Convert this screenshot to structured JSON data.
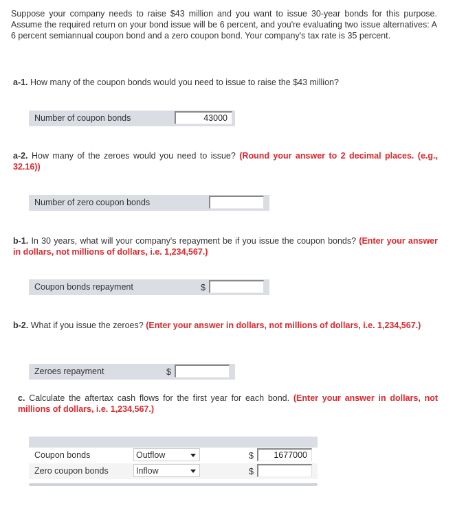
{
  "intro": "Suppose your company needs to raise $43 million and you want to issue 30-year bonds for this purpose. Assume the required return on your bond issue will be 6 percent, and you're evaluating two issue alternatives: A 6 percent semiannual coupon bond and a zero coupon bond. Your company's tax rate is 35 percent.",
  "questions": {
    "a1": {
      "label": "a-1.",
      "text": "How many of the coupon bonds would you need to issue to raise the $43 million?",
      "hint": ""
    },
    "a2": {
      "label": "a-2.",
      "text": "How many of the zeroes would you need to issue?",
      "hint": "(Round your answer to 2 decimal places. (e.g., 32.16))"
    },
    "b1": {
      "label": "b-1.",
      "text": "In 30 years, what will your company's repayment be if you issue the coupon bonds?",
      "hint": "(Enter your answer in dollars, not millions of dollars, i.e. 1,234,567.)"
    },
    "b2": {
      "label": "b-2.",
      "text": "What if you issue the zeroes?",
      "hint": "(Enter your answer in dollars, not millions of dollars, i.e. 1,234,567.)"
    },
    "c": {
      "label": "c.",
      "text": "Calculate the aftertax cash flows for the first year for each bond.",
      "hint": "(Enter your answer in dollars, not millions of dollars, i.e. 1,234,567.)"
    }
  },
  "fields": {
    "coupon_count": {
      "label": "Number of coupon bonds",
      "value": "43000"
    },
    "zero_count": {
      "label": "Number of zero coupon bonds",
      "value": ""
    },
    "coupon_repay": {
      "label": "Coupon bonds repayment",
      "currency": "$",
      "value": ""
    },
    "zero_repay": {
      "label": "Zeroes repayment",
      "currency": "$",
      "value": ""
    }
  },
  "cashflow": {
    "rows": [
      {
        "label": "Coupon bonds",
        "direction": "Outflow",
        "currency": "$",
        "value": "1677000"
      },
      {
        "label": "Zero coupon bonds",
        "direction": "Inflow",
        "currency": "$",
        "value": ""
      }
    ]
  }
}
